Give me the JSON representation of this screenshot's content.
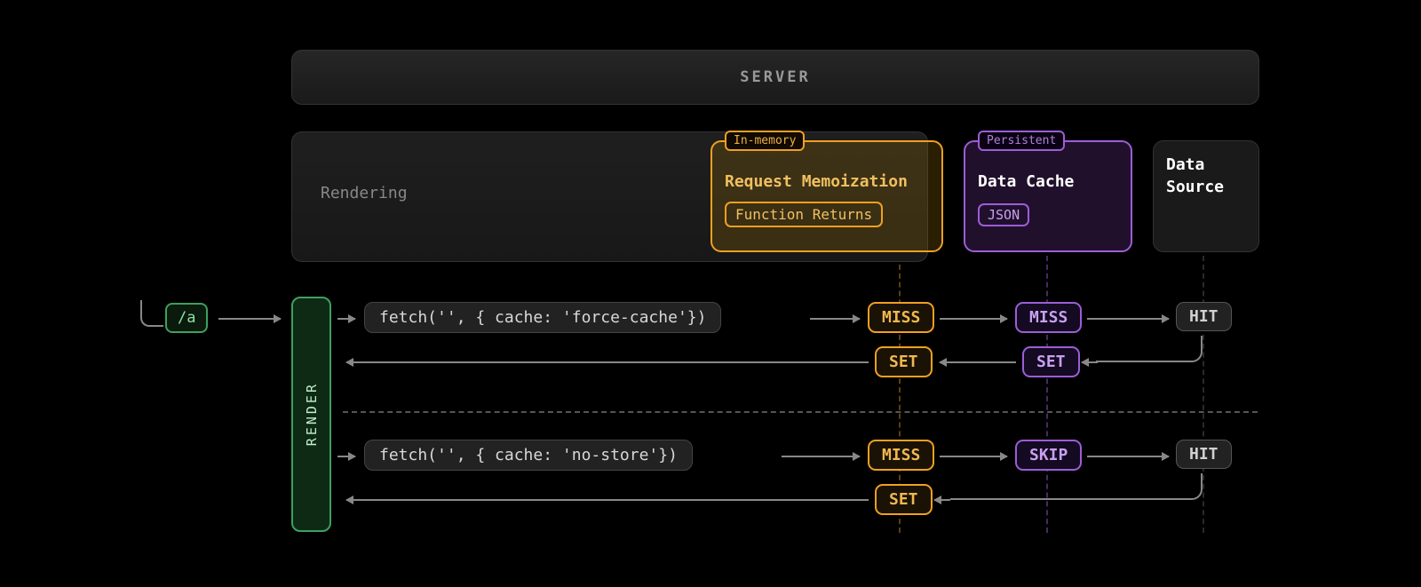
{
  "server": {
    "label": "SERVER"
  },
  "rendering": {
    "label": "Rendering"
  },
  "memo": {
    "tag": "In-memory",
    "title": "Request Memoization",
    "sub": "Function Returns"
  },
  "cache": {
    "tag": "Persistent",
    "title": "Data Cache",
    "sub": "JSON"
  },
  "source": {
    "line1": "Data",
    "line2": "Source"
  },
  "route": {
    "path": "/a"
  },
  "render": {
    "label": "RENDER"
  },
  "flow1": {
    "code": "fetch('', { cache: 'force-cache'})",
    "memo": "MISS",
    "cache": "MISS",
    "source": "HIT",
    "memo_set": "SET",
    "cache_set": "SET"
  },
  "flow2": {
    "code": "fetch('', { cache: 'no-store'})",
    "memo": "MISS",
    "cache": "SKIP",
    "source": "HIT",
    "memo_set": "SET"
  }
}
